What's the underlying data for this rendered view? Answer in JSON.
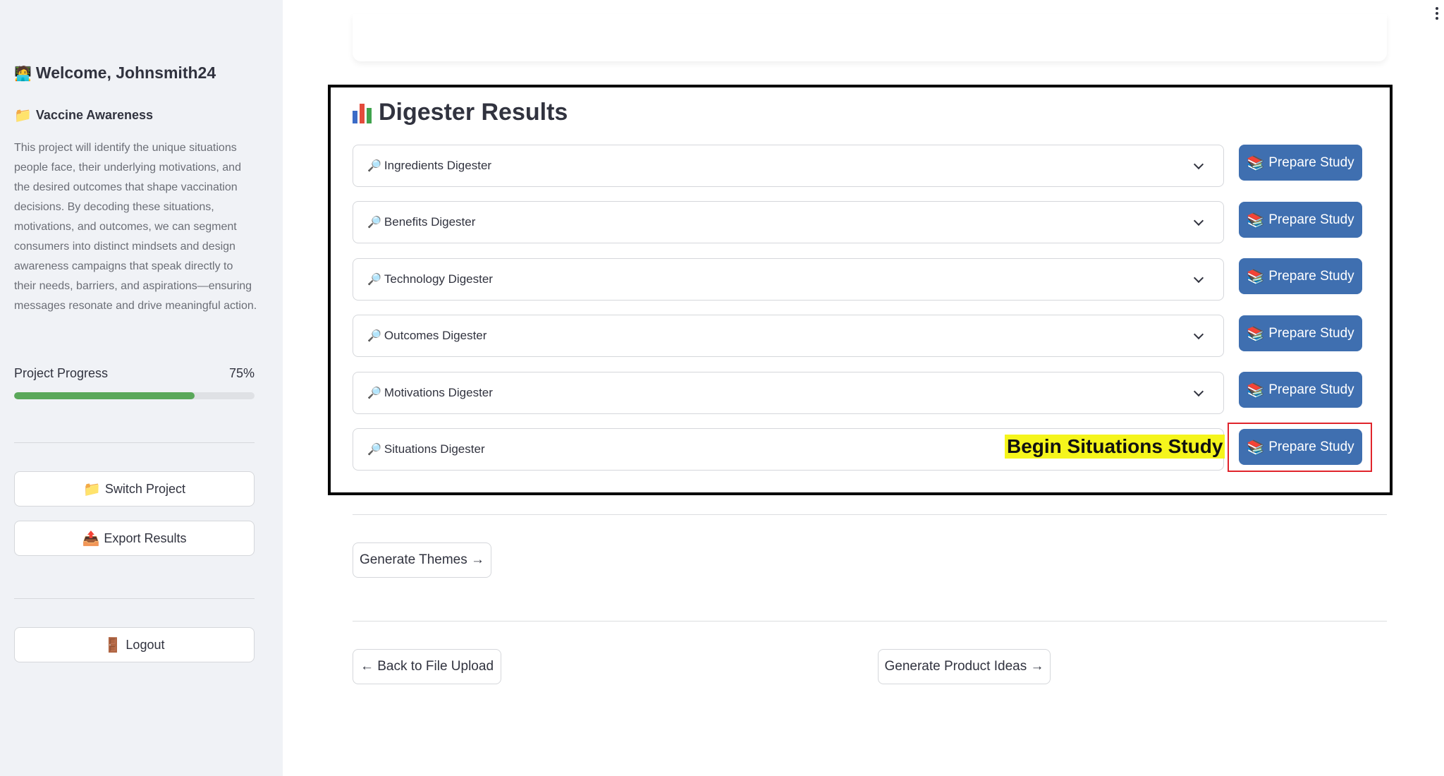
{
  "sidebar": {
    "welcome_emoji": "🧑‍💻",
    "welcome_text": "Welcome, Johnsmith24",
    "project_icon": "📁",
    "project_title": "Vaccine Awareness",
    "project_description": "This project will identify the unique situations people face, their underlying motivations, and the desired outcomes that shape vaccination decisions. By decoding these situations, motivations, and outcomes, we can segment consumers into distinct mindsets and design awareness campaigns that speak directly to their needs, barriers, and aspirations—ensuring messages resonate and drive meaningful action.",
    "progress_label": "Project Progress",
    "progress_text": "75%",
    "progress_value": 0.75,
    "progress_color": "#5aa85a",
    "switch_icon": "📁",
    "switch_label": "Switch Project",
    "export_icon": "📤",
    "export_label": "Export Results",
    "logout_icon": "🚪",
    "logout_label": "Logout"
  },
  "main": {
    "results_title": "Digester Results",
    "results_icon": "bar-chart-icon",
    "expanders": [
      {
        "label": "Ingredients Digester",
        "icon": "🔎"
      },
      {
        "label": "Benefits Digester",
        "icon": "🔎"
      },
      {
        "label": "Technology Digester",
        "icon": "🔎"
      },
      {
        "label": "Outcomes Digester",
        "icon": "🔎"
      },
      {
        "label": "Motivations Digester",
        "icon": "🔎"
      },
      {
        "label": "Situations Digester",
        "icon": "🔎"
      }
    ],
    "prepare_label": "Prepare Study",
    "prepare_icon": "📚",
    "prepare_color": "#3f6fb0",
    "annotation": "Begin Situations Study",
    "generate_themes": "Generate Themes →",
    "back_button": "← Back to File Upload",
    "product_ideas_button": "Generate Product Ideas →"
  }
}
